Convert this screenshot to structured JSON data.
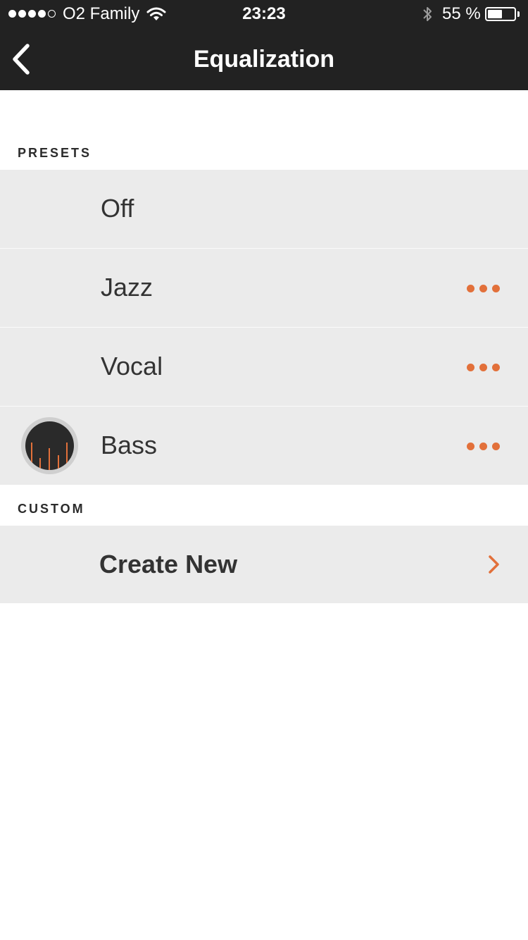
{
  "status_bar": {
    "carrier": "O2 Family",
    "signal_bars_filled": 4,
    "signal_bars_total": 5,
    "time": "23:23",
    "battery_percent_text": "55 %",
    "battery_level": 0.55,
    "icons": [
      "signal-dots",
      "wifi-icon",
      "bluetooth-icon",
      "battery-icon"
    ]
  },
  "nav": {
    "back_icon": "chevron-left-icon",
    "title": "Equalization"
  },
  "sections": {
    "presets": {
      "header": "PRESETS",
      "items": [
        {
          "label": "Off",
          "has_more": false,
          "selected": false
        },
        {
          "label": "Jazz",
          "has_more": true,
          "selected": false
        },
        {
          "label": "Vocal",
          "has_more": true,
          "selected": false
        },
        {
          "label": "Bass",
          "has_more": true,
          "selected": true
        }
      ],
      "selected_icon": "equalizer-icon",
      "more_icon": "more-dots-icon"
    },
    "custom": {
      "header": "CUSTOM",
      "create_label": "Create New",
      "create_icon": "chevron-right-icon"
    }
  },
  "colors": {
    "nav_background": "#222222",
    "row_background": "#ebebeb",
    "accent": "#e2703a",
    "text": "#333333"
  }
}
